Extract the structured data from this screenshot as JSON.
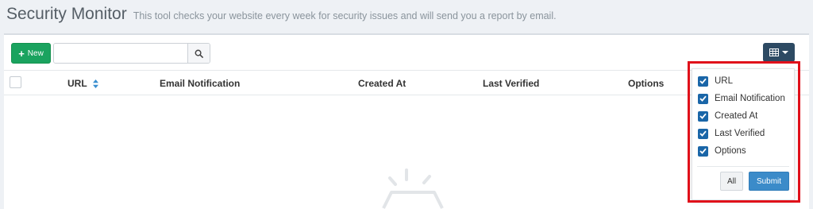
{
  "header": {
    "title": "Security Monitor",
    "subtitle": "This tool checks your website every week for security issues and will send you a report by email."
  },
  "toolbar": {
    "new_label": "New",
    "search": {
      "value": "",
      "placeholder": ""
    },
    "columns_button_icon": "table-icon"
  },
  "table": {
    "columns": [
      "URL",
      "Email Notification",
      "Created At",
      "Last Verified",
      "Options"
    ],
    "rows": []
  },
  "column_menu": {
    "options": [
      {
        "label": "URL",
        "checked": true
      },
      {
        "label": "Email Notification",
        "checked": true
      },
      {
        "label": "Created At",
        "checked": true
      },
      {
        "label": "Last Verified",
        "checked": true
      },
      {
        "label": "Options",
        "checked": true
      }
    ],
    "all_label": "All",
    "submit_label": "Submit"
  },
  "colors": {
    "new_button": "#1aa35f",
    "columns_button": "#2d4a63",
    "checkbox": "#1a66a8",
    "submit_button": "#3b8bc9",
    "highlight": "#e0101a"
  }
}
